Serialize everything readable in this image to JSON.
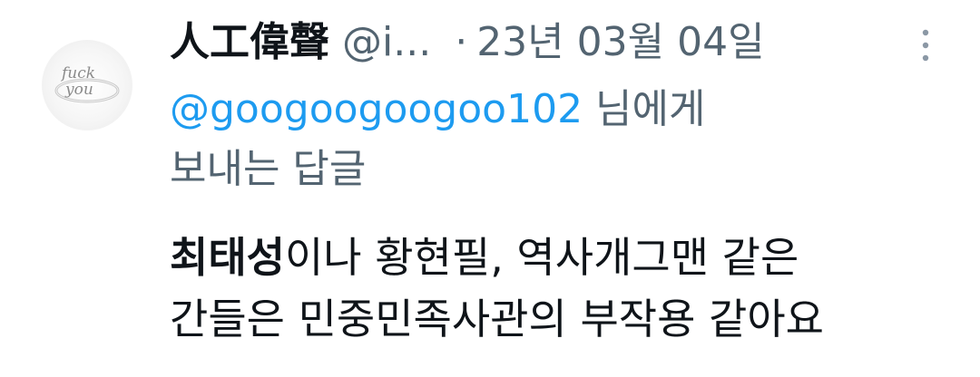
{
  "author": {
    "display_name": "人工偉聲",
    "handle": "@i...",
    "separator": "·",
    "timestamp": "23년 03월 04일",
    "avatar_text": [
      "fuck",
      "you"
    ]
  },
  "reply_context": {
    "mention": "@googoogoogoo102",
    "suffix_line1": " 님에게",
    "line2": "보내는 답글"
  },
  "body": {
    "bold_name": "최태성",
    "line1_rest": "이나 황현필, 역사개그맨 같은",
    "line2": "간들은 민중민족사관의 부작용 같아요"
  },
  "icons": {
    "more": "more-vertical-icon"
  },
  "colors": {
    "text": "#0f1419",
    "secondary": "#536471",
    "link": "#1d9bf0"
  }
}
